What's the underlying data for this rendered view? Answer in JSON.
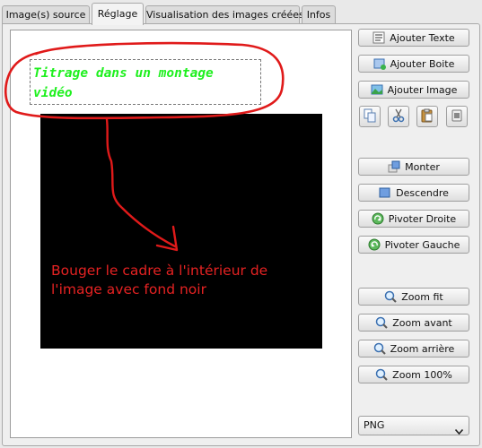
{
  "tabs": [
    {
      "label": "Image(s) source",
      "active": false
    },
    {
      "label": "Réglage",
      "active": true
    },
    {
      "label": "Visualisation des images créées",
      "active": false
    },
    {
      "label": "Infos",
      "active": false
    }
  ],
  "canvas": {
    "title_text": "Titrage dans un montage vidéo",
    "instruction_text": "Bouger le cadre à l'intérieur de l'image avec fond noir",
    "title_color": "#1ef01e",
    "annotation_color": "#e01a1a",
    "image_background": "#000000"
  },
  "buttons": {
    "add_text": "Ajouter Texte",
    "add_box": "Ajouter Boite",
    "add_image": "Ajouter Image",
    "raise": "Monter",
    "lower": "Descendre",
    "rotate_right": "Pivoter Droite",
    "rotate_left": "Pivoter Gauche",
    "zoom_fit": "Zoom fit",
    "zoom_in": "Zoom avant",
    "zoom_out": "Zoom arrière",
    "zoom_100": "Zoom 100%"
  },
  "edit_icons": [
    "copy-icon",
    "cut-icon",
    "paste-icon",
    "delete-icon"
  ],
  "format_select": {
    "value": "PNG"
  }
}
